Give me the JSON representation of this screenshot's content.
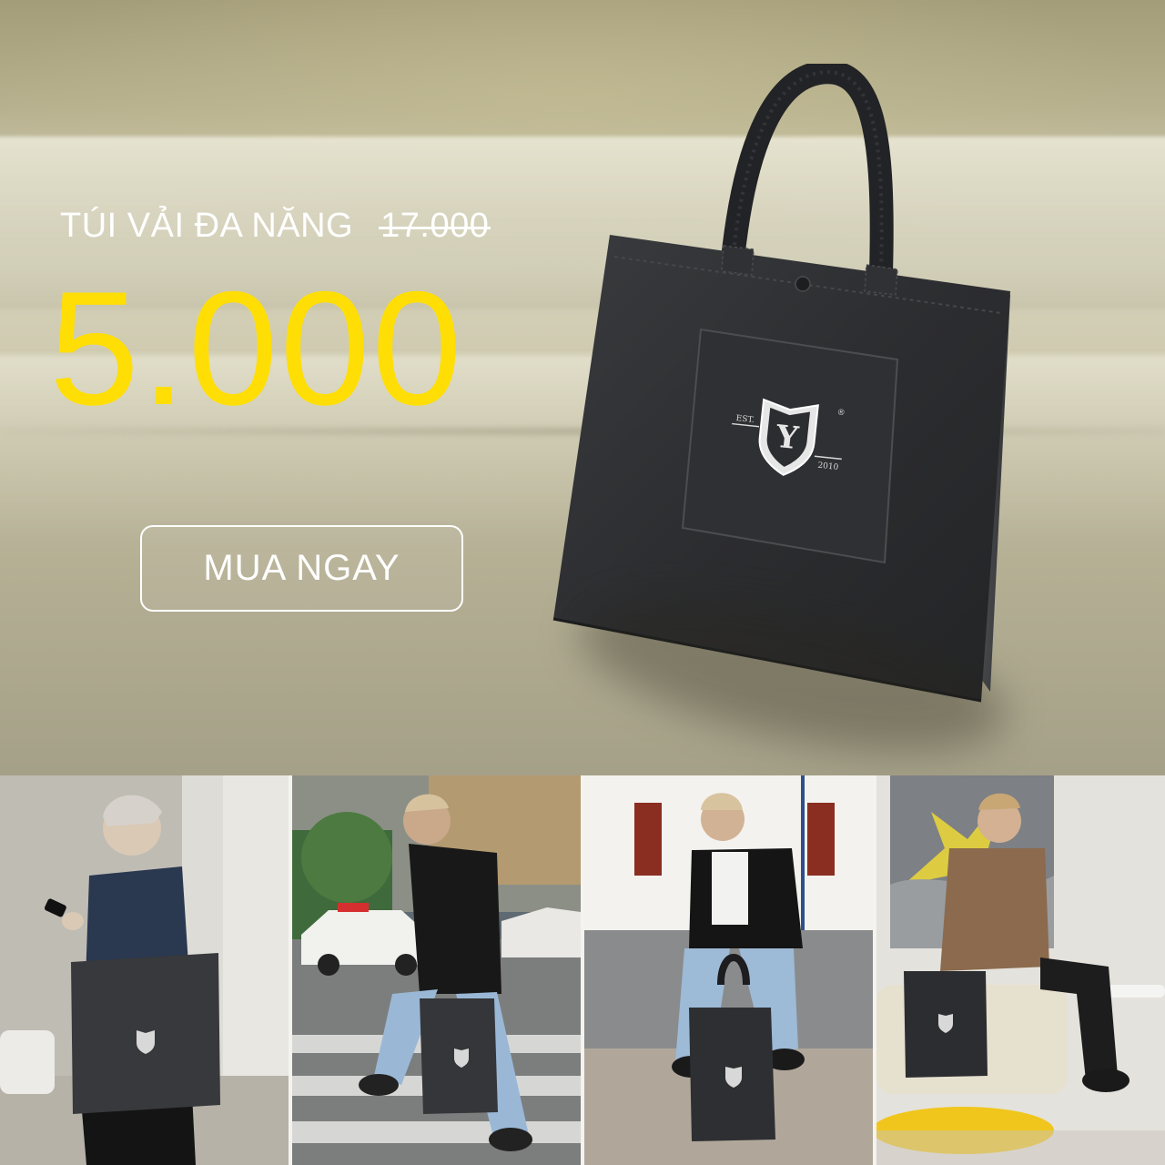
{
  "hero": {
    "product_name": "TÚI VẢI ĐA NĂNG",
    "old_price": "17.000",
    "new_price": "5.000",
    "cta_label": "MUA NGAY",
    "colors": {
      "price": "#ffde05",
      "text": "#ffffff",
      "bag": "#2a2b2d"
    }
  },
  "bag": {
    "logo_letter": "Y",
    "logo_left": "EST.",
    "logo_right": "2010",
    "logo_mark": "®"
  },
  "gallery": [
    {
      "scene": "model-leaning-wall-with-phone"
    },
    {
      "scene": "model-crossing-street-with-taxi"
    },
    {
      "scene": "model-sitting-by-building"
    },
    {
      "scene": "model-seated-near-painting"
    }
  ]
}
